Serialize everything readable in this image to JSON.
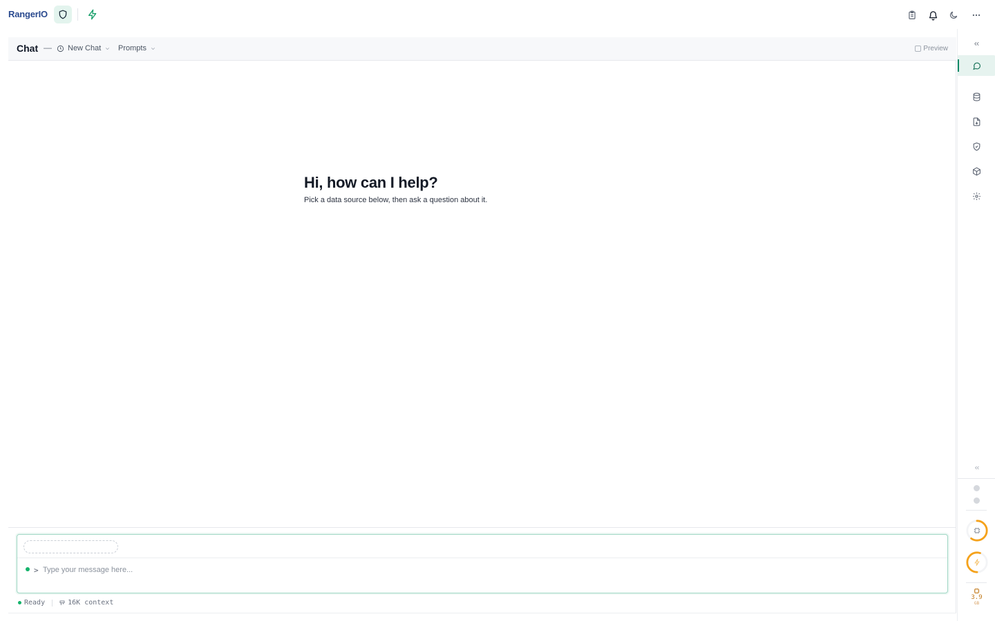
{
  "app": {
    "logo_text": "RangerIO"
  },
  "topbar": {
    "shield_icon": "shield-icon",
    "bolt_icon": "bolt-icon",
    "right_icons": [
      "clipboard-icon",
      "bell-icon",
      "moon-icon",
      "more-icon"
    ]
  },
  "chat": {
    "title": "Chat",
    "dash": "—",
    "history_label": "New Chat",
    "prompts_label": "Prompts",
    "preview_label": "Preview"
  },
  "welcome": {
    "title": "Hi, how can I help?",
    "subtitle": "Pick a data source below, then ask a question about it."
  },
  "composer": {
    "placeholder": "Type your message here...",
    "caret": ">",
    "value": ""
  },
  "status": {
    "state": "Ready",
    "context": "16K context"
  },
  "rail": {
    "items": [
      "chat-icon",
      "database-icon",
      "file-icon",
      "shield-check-icon",
      "package-icon",
      "settings-icon"
    ],
    "active": "chat-icon",
    "cpu_usage_fraction": 0.6,
    "gpu_usage_fraction": 0.55,
    "memory_value": "3.9",
    "memory_unit": "GB"
  },
  "colors": {
    "accent": "#0f8a67",
    "logo": "#2a4a8f",
    "status_ok": "#14b36b",
    "gauge": "#f5a21b"
  }
}
